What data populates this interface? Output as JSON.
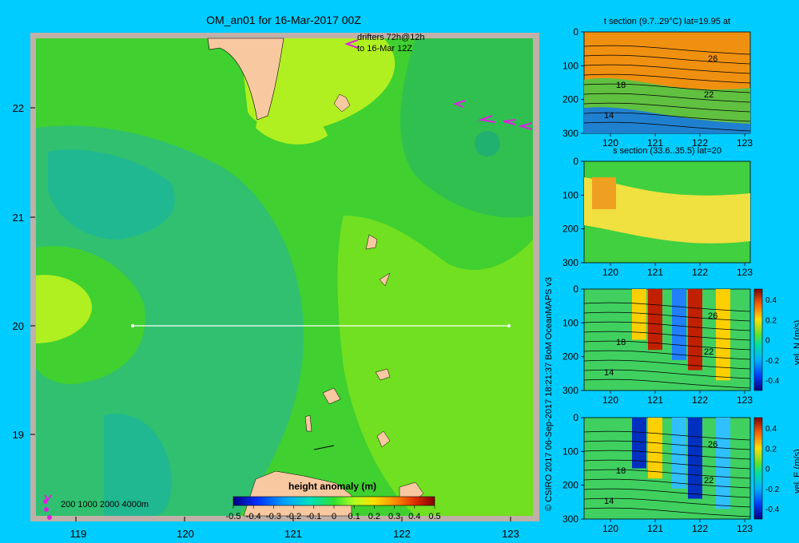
{
  "title": "OM_an01 for 16-Mar-2017 00Z",
  "drifters": {
    "line1": "drifters 72h@12h",
    "line2": "to 16-Mar 12Z"
  },
  "map": {
    "lat_ticks": [
      "22",
      "21",
      "20",
      "19"
    ],
    "lon_ticks": [
      "119",
      "120",
      "121",
      "122",
      "123"
    ],
    "depth_legend": "200  1000  2000  4000m",
    "colorbar_title": "height anomaly  (m)",
    "colorbar_ticks": [
      "-0.5",
      "-0.4",
      "-0.3",
      "-0.2",
      "-0.1",
      "0",
      "0.1",
      "0.2",
      "0.3",
      "0.4",
      "0.5"
    ]
  },
  "credit": "© CSIRO 2017   06-Sep-2017 18:21:37 BoM OceanMAPS v3",
  "panels": [
    {
      "title": "t section (9.7..29°C) lat=19.95 at",
      "contour_labels": [
        "26",
        "18",
        "22",
        "14"
      ],
      "side_label": "",
      "cb_ticks": []
    },
    {
      "title": "s section (33.6..35.5) lat=20",
      "contour_labels": [],
      "side_label": "",
      "cb_ticks": []
    },
    {
      "title": "",
      "contour_labels": [
        "26",
        "18",
        "22",
        "14"
      ],
      "side_label": "vel. N (m/s)",
      "cb_ticks": [
        "0.4",
        "0.2",
        "0",
        "-0.2",
        "-0.4"
      ]
    },
    {
      "title": "",
      "contour_labels": [
        "26",
        "18",
        "22",
        "14"
      ],
      "side_label": "vel. E (m/s)",
      "cb_ticks": [
        "0.4",
        "0.2",
        "0",
        "-0.2",
        "-0.4"
      ]
    }
  ],
  "panel_axes": {
    "y_ticks": [
      "0",
      "100",
      "200",
      "300"
    ],
    "x_ticks": [
      "120",
      "121",
      "122",
      "123"
    ]
  },
  "colors": {
    "background": "#00ccff",
    "land": "#f8c8a0",
    "shelf": "#c0b0a8",
    "drifter": "#e020e0"
  }
}
